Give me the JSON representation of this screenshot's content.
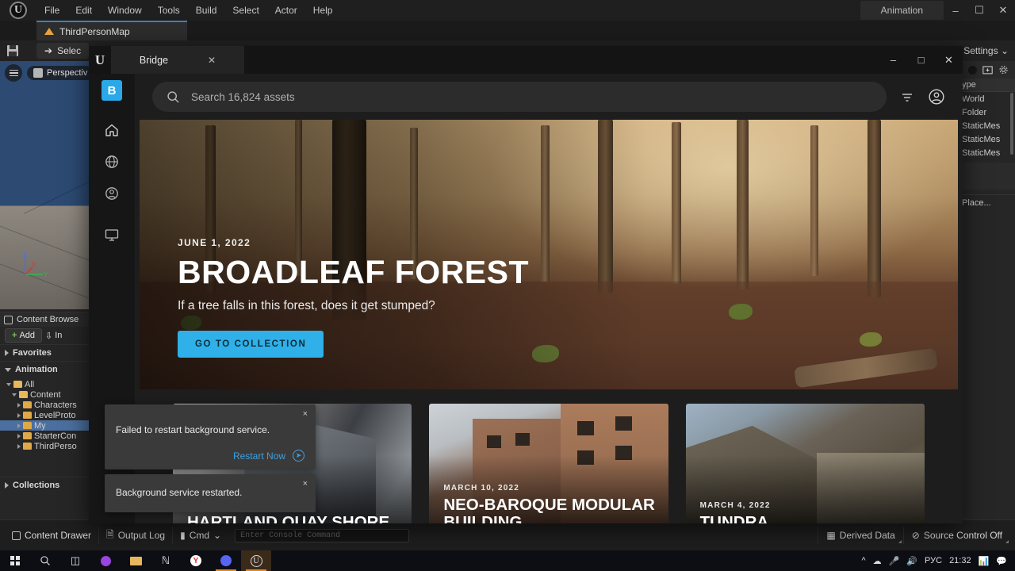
{
  "editor": {
    "menu": [
      "File",
      "Edit",
      "Window",
      "Tools",
      "Build",
      "Select",
      "Actor",
      "Help"
    ],
    "level_tab": "ThirdPersonMap",
    "animation_tab": "Animation",
    "toolbar": {
      "select_label": "Selec",
      "settings_label": "Settings"
    },
    "viewport": {
      "perspective_label": "Perspectiv",
      "axis_z": "Z",
      "axis_x": "X",
      "axis_y": "Y"
    },
    "content_browser": {
      "title": "Content Browse",
      "add_label": "Add",
      "import_label": "In",
      "sections": [
        {
          "label": "Favorites",
          "expanded": false
        },
        {
          "label": "Animation",
          "expanded": true
        },
        {
          "label": "Collections",
          "expanded": false
        }
      ],
      "tree": [
        {
          "label": "All",
          "depth": 0,
          "expanded": true,
          "selected": false
        },
        {
          "label": "Content",
          "depth": 1,
          "expanded": true,
          "selected": false
        },
        {
          "label": "Characters",
          "depth": 2,
          "expanded": false,
          "selected": false
        },
        {
          "label": "LevelProto",
          "depth": 2,
          "expanded": false,
          "selected": false
        },
        {
          "label": "My",
          "depth": 2,
          "expanded": false,
          "selected": true
        },
        {
          "label": "StarterCon",
          "depth": 2,
          "expanded": false,
          "selected": false
        },
        {
          "label": "ThirdPerso",
          "depth": 2,
          "expanded": false,
          "selected": false
        }
      ]
    },
    "outliner": {
      "column_header": "ype",
      "rows": [
        "World",
        "Folder",
        "StaticMes",
        "StaticMes",
        "StaticMes"
      ],
      "place_label": "Place..."
    },
    "status_bar": {
      "content_drawer": "Content Drawer",
      "output_log": "Output Log",
      "cmd": "Cmd",
      "console_placeholder": "Enter Console Command",
      "derived_data": "Derived Data",
      "source_control": "Source Control Off"
    }
  },
  "bridge": {
    "window_title": "Bridge",
    "nav_logo": "B",
    "nav_items": [
      "home-icon",
      "globe-icon",
      "account-icon",
      "local-icon"
    ],
    "search": {
      "placeholder": "Search 16,824 assets"
    },
    "hero": {
      "date": "JUNE 1, 2022",
      "title": "BROADLEAF FOREST",
      "subtitle": "If a tree falls in this forest, does it get stumped?",
      "cta": "GO TO COLLECTION",
      "cta_color": "#2fb0e8"
    },
    "cards": [
      {
        "date": "",
        "title": "HARTLAND QUAY SHORE"
      },
      {
        "date": "MARCH 10, 2022",
        "title": "NEO-BAROQUE MODULAR BUILDING"
      },
      {
        "date": "MARCH 4, 2022",
        "title": "TUNDRA"
      }
    ]
  },
  "toasts": [
    {
      "message": "Failed to restart background service.",
      "action": "Restart Now",
      "close": "×"
    },
    {
      "message": "Background service restarted.",
      "action": "",
      "close": "×"
    }
  ],
  "taskbar": {
    "language": "РУС",
    "time": "21:32"
  }
}
